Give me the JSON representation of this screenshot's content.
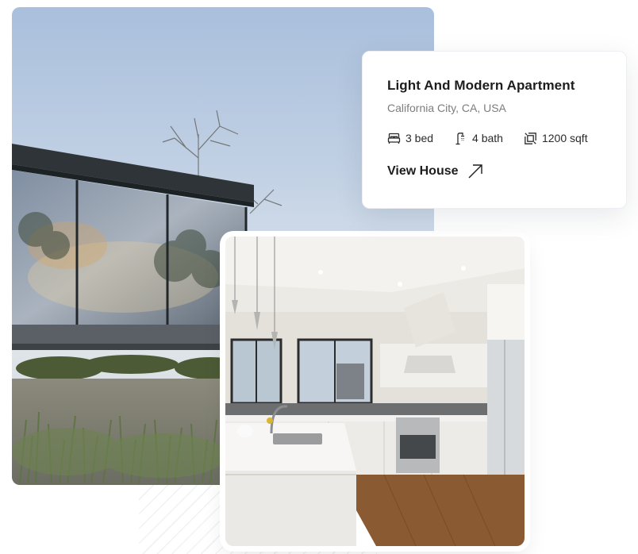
{
  "listing": {
    "title": "Light And Modern Apartment",
    "location": "California City, CA, USA",
    "features": [
      {
        "icon": "bed-icon",
        "label": "3 bed"
      },
      {
        "icon": "bath-icon",
        "label": "4 bath"
      },
      {
        "icon": "area-icon",
        "label": "1200 sqft"
      }
    ],
    "cta": {
      "label": "View House",
      "icon": "arrow-up-right-icon"
    }
  },
  "photos": [
    {
      "name": "exterior-house-photo",
      "subject": "modern glass house exterior at dusk"
    },
    {
      "name": "kitchen-interior-photo",
      "subject": "bright white kitchen interior"
    }
  ],
  "colors": {
    "text_primary": "#1d1d1d",
    "text_secondary": "#7d7d7d",
    "card_bg": "#ffffff"
  }
}
